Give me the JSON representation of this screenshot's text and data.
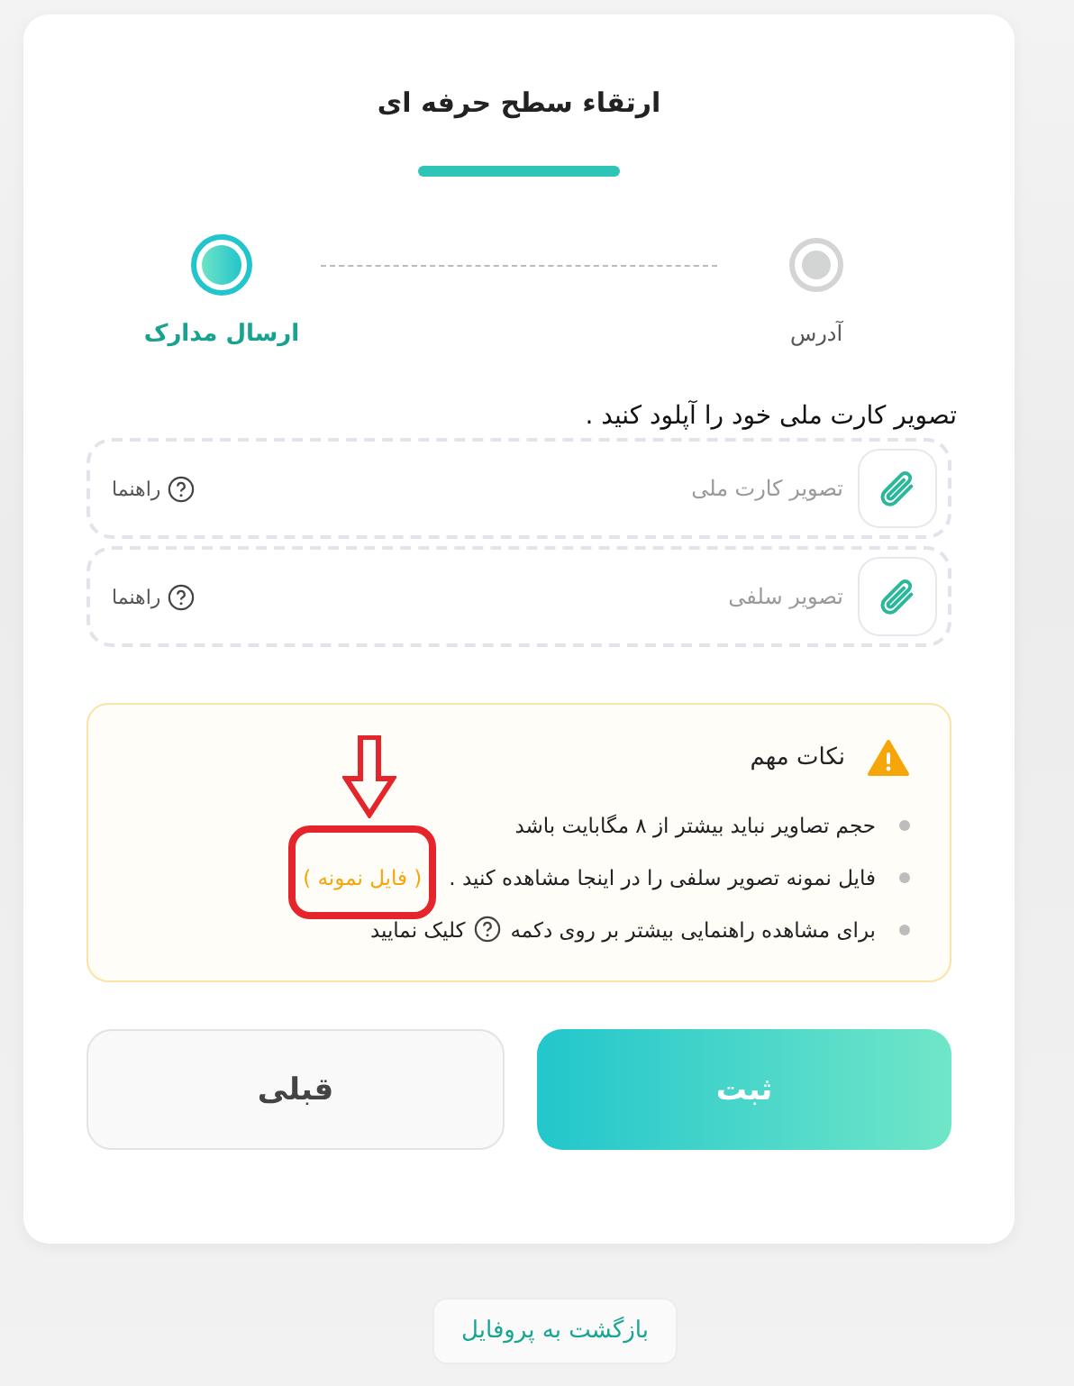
{
  "title": "ارتقاء سطح حرفه ای",
  "steps": [
    {
      "label": "آدرس",
      "selected": false
    },
    {
      "label": "ارسال مدارک",
      "selected": true
    }
  ],
  "instruction": "تصویر کارت ملی خود را آپلود کنید .",
  "uploads": [
    {
      "label": "تصویر کارت ملی",
      "help": "راهنما"
    },
    {
      "label": "تصویر سلفی",
      "help": "راهنما"
    }
  ],
  "notes": {
    "title": "نکات مهم",
    "items": [
      {
        "kind": "text",
        "text": "حجم تصاویر نباید بیشتر از ۸ مگابایت باشد"
      },
      {
        "kind": "link",
        "text": "فایل نمونه تصویر سلفی را در اینجا مشاهده کنید .",
        "link": "( فایل نمونه )",
        "highlighted": true
      },
      {
        "kind": "help",
        "text": "برای مشاهده راهنمایی بیشتر بر روی دکمه",
        "after": "کلیک نمایید"
      }
    ]
  },
  "buttons": [
    {
      "kind": "primary",
      "label": "ثبت"
    },
    {
      "kind": "secondary",
      "label": "قبلی"
    }
  ],
  "back_link": "بازگشت به پروفایل"
}
